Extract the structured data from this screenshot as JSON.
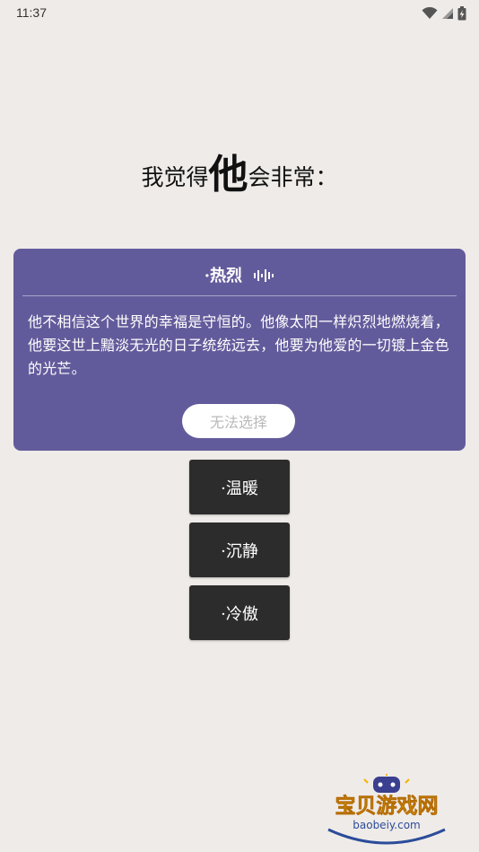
{
  "status_bar": {
    "time": "11:37",
    "icons": [
      "wifi-icon",
      "signal-icon",
      "battery-charging-icon"
    ]
  },
  "title": {
    "prefix": "我觉得",
    "emphasis": "他",
    "suffix": "会非常："
  },
  "selected_option": {
    "label": "·热烈",
    "icon": "soundwave-icon",
    "description": "他不相信这个世界的幸福是守恒的。他像太阳一样炽烈地燃烧着，他要这世上黯淡无光的日子统统远去，他要为他爱的一切镀上金色的光芒。",
    "button_label": "无法选择"
  },
  "options": [
    {
      "label": "·温暖"
    },
    {
      "label": "·沉静"
    },
    {
      "label": "·冷傲"
    }
  ],
  "watermark": {
    "text": "宝贝游戏网",
    "url_text": "baobeiy.com"
  },
  "colors": {
    "background": "#efebe8",
    "card": "#625b9b",
    "option_button": "#2d2c2c",
    "disabled_text": "#b9b9b9"
  }
}
